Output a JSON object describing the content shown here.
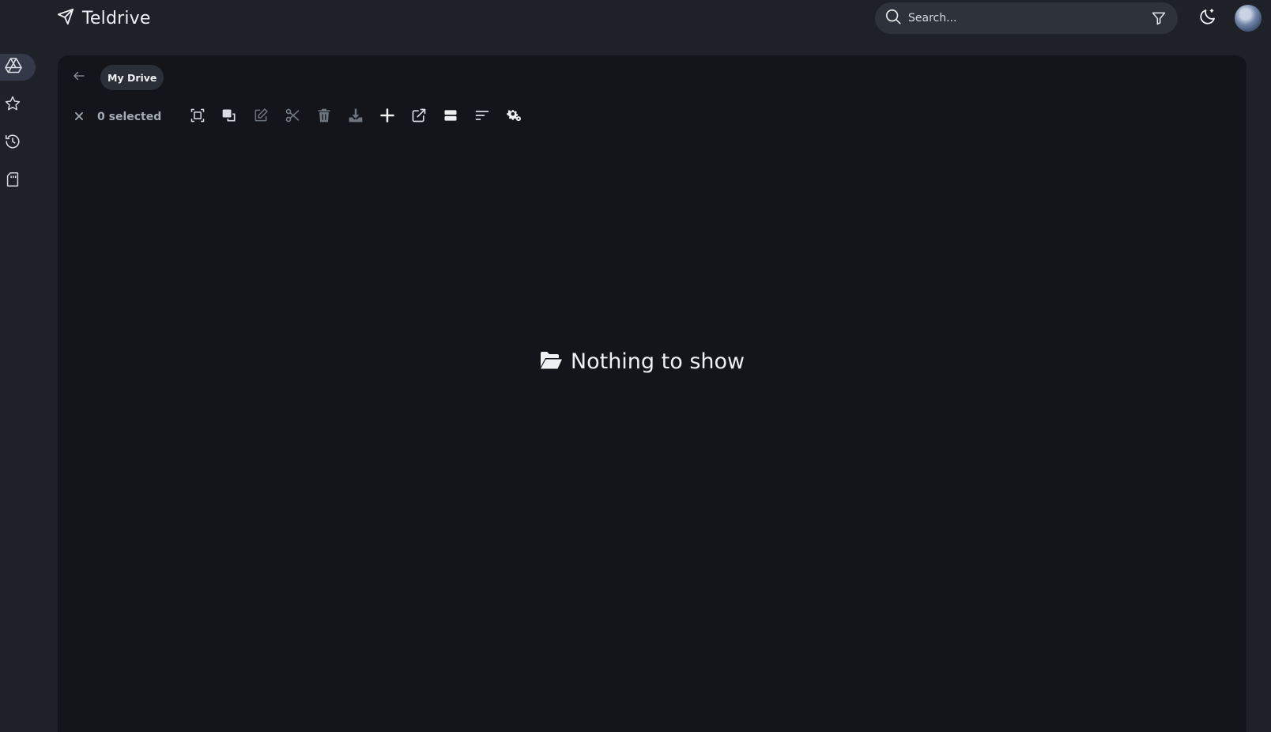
{
  "app": {
    "title": "Teldrive"
  },
  "search": {
    "placeholder": "Search..."
  },
  "sidebar": {
    "items": [
      {
        "icon": "drive-icon",
        "active": true
      },
      {
        "icon": "star-icon",
        "active": false
      },
      {
        "icon": "history-icon",
        "active": false
      },
      {
        "icon": "storage-icon",
        "active": false
      }
    ]
  },
  "breadcrumb": {
    "current": "My Drive"
  },
  "toolbar": {
    "selected_label": "0 selected",
    "tools": [
      "select-all-icon",
      "copy-icon",
      "rename-icon",
      "cut-icon",
      "delete-icon",
      "download-icon",
      "add-icon",
      "open-external-icon",
      "view-toggle-icon",
      "sort-icon",
      "settings-icon"
    ]
  },
  "empty_state": {
    "message": "Nothing to show",
    "icon": "folder-open-icon"
  },
  "colors": {
    "background": "#1e2228",
    "panel": "#13151a",
    "accent": "#34394a"
  }
}
